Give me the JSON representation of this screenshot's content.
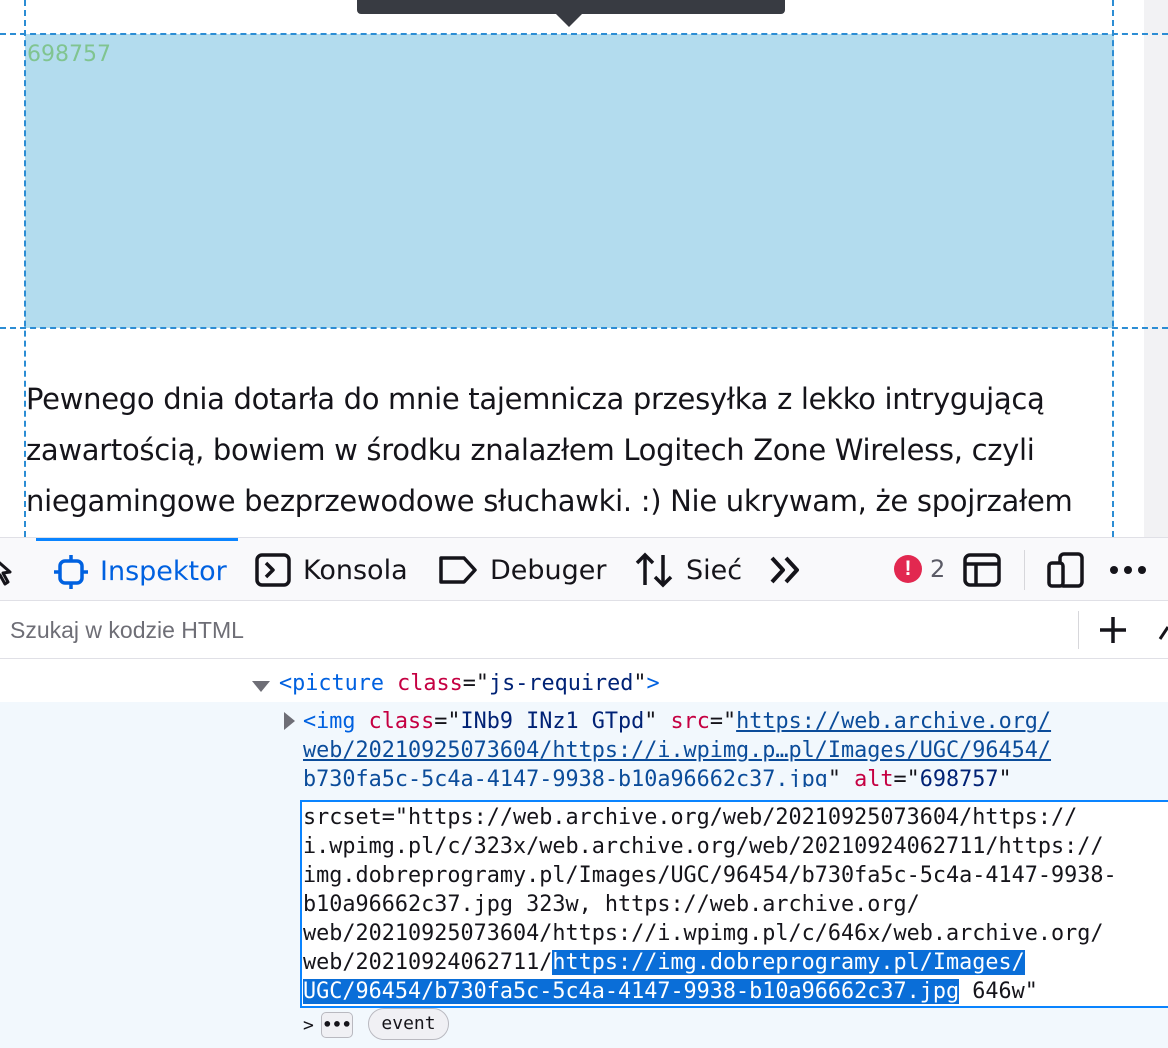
{
  "page": {
    "image_alt": "698757",
    "article_lines": [
      "Pewnego dnia dotarła do mnie tajemnicza przesyłka z lekko intrygującą",
      "zawartością, bowiem w środku znalazłem Logitech Zone Wireless, czyli",
      "niegamingowe bezprzewodowe słuchawki. :) Nie ukrywam, że spojrzałem"
    ]
  },
  "toolbar": {
    "tabs": {
      "inspector": "Inspektor",
      "console": "Konsola",
      "debugger": "Debuger",
      "network": "Sieć"
    },
    "error_count": "2"
  },
  "search": {
    "placeholder": "Szukaj w kodzie HTML"
  },
  "markup": {
    "picture": {
      "tag": "picture",
      "attr": "class",
      "value": "js-required"
    },
    "img": {
      "tag": "img",
      "class_attr": "class",
      "class_value": "INb9 INz1 GTpd",
      "src_attr": "src",
      "src_line1": "https://web.archive.org/",
      "src_line2": "web/20210925073604/https://i.wpimg.p…pl/Images/UGC/96454/",
      "src_line3": "b730fa5c-5c4a-4147-9938-b10a96662c37.jpg",
      "alt_attr": "alt",
      "alt_value": "698757",
      "srcset_lines": [
        "srcset=\"https://web.archive.org/web/20210925073604/https://",
        "i.wpimg.pl/c/323x/web.archive.org/web/20210924062711/https://",
        "img.dobreprogramy.pl/Images/UGC/96454/b730fa5c-5c4a-4147-9938-",
        "b10a96662c37.jpg 323w, https://web.archive.org/",
        "web/20210925073604/https://i.wpimg.pl/c/646x/web.archive.org/"
      ],
      "srcset_line6_prefix": "web/20210924062711/",
      "srcset_line6_selected": "https://img.dobreprogramy.pl/Images/",
      "srcset_line7_selected": "UGC/96454/b730fa5c-5c4a-4147-9938-b10a96662c37.jpg",
      "srcset_line7_suffix": " 646w\""
    },
    "ellipsis": "•••",
    "event_badge": "event"
  }
}
